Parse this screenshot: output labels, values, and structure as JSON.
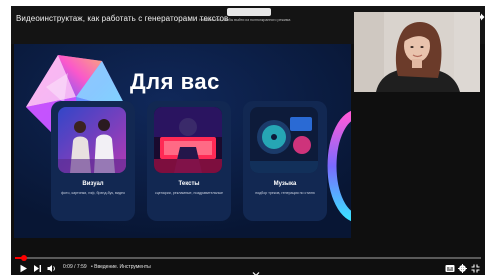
{
  "player": {
    "title": "Видеоинструктаж, как работать с генераторами текстов",
    "notice": "Нажмите Esc, чтобы выйти из полноэкранного режима"
  },
  "slide": {
    "title": "Для вас",
    "cards": [
      {
        "name": "Визуал",
        "desc": "фото, картинки, гиф, брэнд-бук, видео"
      },
      {
        "name": "Тексты",
        "desc": "сценарии, рекламные, поздравительные"
      },
      {
        "name": "Музыка",
        "desc": "подбор треков, генерация по стилю"
      }
    ]
  },
  "controls": {
    "time": "0:09 / 7:59",
    "chapter": "• Введение. Инструменты",
    "progress_fraction": 0.02
  },
  "icons": {
    "play": "play-icon",
    "next": "next-icon",
    "volume": "volume-icon",
    "clock": "watch-later-icon",
    "share": "share-icon",
    "subtitles": "subtitles-icon",
    "settings": "gear-icon",
    "fullscreen": "exit-fullscreen-icon"
  },
  "colors": {
    "progress": "#ff0000",
    "slide_bg": "#0a1a3c",
    "card_bg": "#122852"
  }
}
